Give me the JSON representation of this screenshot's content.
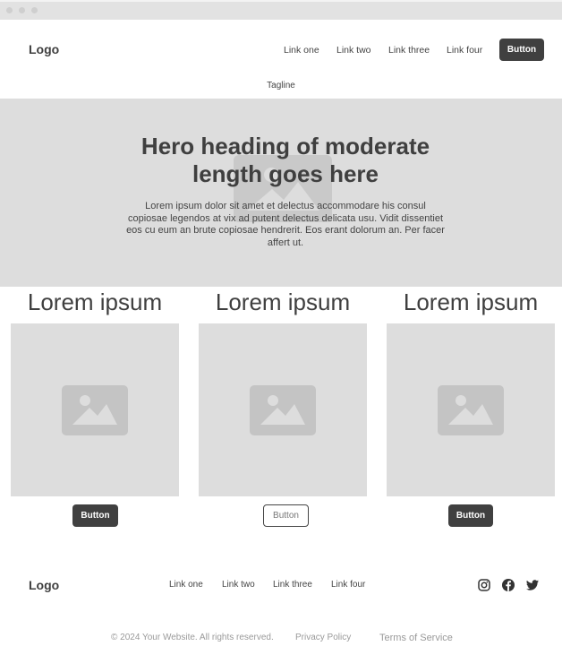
{
  "header": {
    "logo": "Logo",
    "nav": [
      "Link one",
      "Link two",
      "Link three",
      "Link four"
    ],
    "button": "Button",
    "tagline": "Tagline"
  },
  "hero": {
    "heading": "Hero heading of moderate length goes here",
    "body": "Lorem ipsum dolor sit amet et delectus accommodare his consul copiosae legendos at vix ad putent delectus delicata usu. Vidit dissentiet eos cu eum an brute copiosae hendrerit. Eos erant dolorum an. Per facer affert ut.",
    "image_icon": "image-placeholder-icon"
  },
  "cards": [
    {
      "title": "Lorem ipsum",
      "button": "Button",
      "button_style": "filled"
    },
    {
      "title": "Lorem ipsum",
      "button": "Button",
      "button_style": "outline"
    },
    {
      "title": "Lorem ipsum",
      "button": "Button",
      "button_style": "filled"
    }
  ],
  "footer": {
    "logo": "Logo",
    "nav": [
      "Link one",
      "Link two",
      "Link three",
      "Link four"
    ],
    "social": [
      "instagram-icon",
      "facebook-icon",
      "twitter-icon"
    ],
    "copyright": "© 2024 Your Website. All rights reserved.",
    "privacy": "Privacy Policy",
    "terms": "Terms of Service"
  },
  "colors": {
    "dark": "#404040",
    "placeholder": "#dddddd",
    "placeholder_icon": "#c4c4c4",
    "muted_text": "#9a9a9a"
  }
}
